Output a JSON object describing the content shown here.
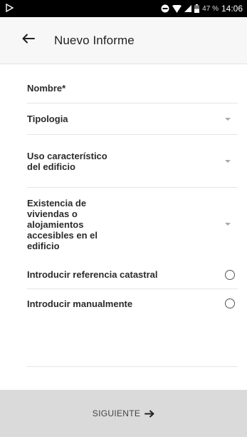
{
  "status_bar": {
    "battery_percent": "47 %",
    "time": "14:06",
    "icons": [
      "play-store-icon",
      "do-not-disturb-icon",
      "wifi-icon",
      "signal-icon",
      "battery-icon"
    ]
  },
  "app_bar": {
    "title": "Nuevo Informe",
    "back_icon": "arrow-left-icon"
  },
  "form": {
    "nombre_label": "Nombre*",
    "tipologia_label": "Tipologia",
    "uso_label": "Uso característico del edificio",
    "existencia_label": "Existencia de viviendas o alojamientos accesibles en el edificio",
    "ref_catastral_label": "Introducir referencia catastral",
    "manual_label": "Introducir manualmente"
  },
  "footer": {
    "next_label": "SIGUIENTE",
    "next_icon": "arrow-right-icon"
  },
  "colors": {
    "status_bar_bg": "#000000",
    "app_bar_bg": "#f7f7f7",
    "footer_bg": "#dadada",
    "text": "#2b2b2b"
  }
}
